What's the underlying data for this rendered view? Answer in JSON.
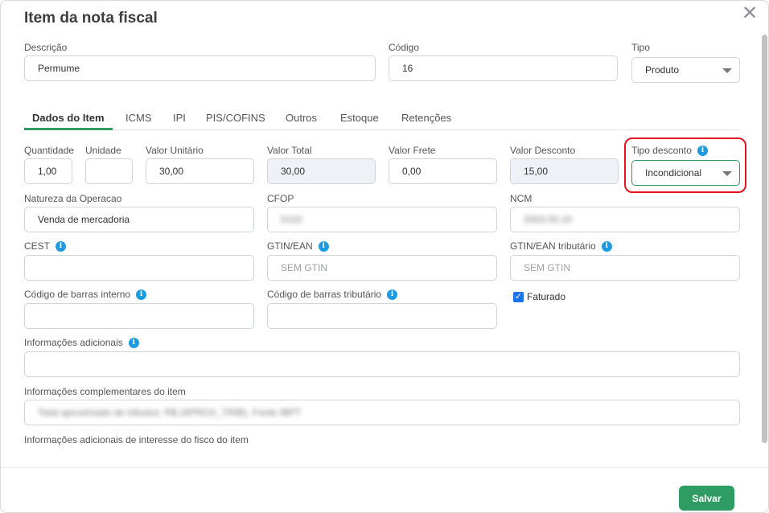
{
  "modal": {
    "title": "Item da nota fiscal",
    "close_glyph": "✕"
  },
  "header_fields": {
    "descricao": {
      "label": "Descrição",
      "value": "Permume"
    },
    "codigo": {
      "label": "Código",
      "value": "16"
    },
    "tipo": {
      "label": "Tipo",
      "value": "Produto"
    }
  },
  "tabs": [
    {
      "label": "Dados do Item",
      "active": true
    },
    {
      "label": "ICMS"
    },
    {
      "label": "IPI"
    },
    {
      "label": "PIS/COFINS"
    },
    {
      "label": "Outros"
    },
    {
      "label": "Estoque"
    },
    {
      "label": "Retenções"
    }
  ],
  "fields": {
    "quantidade": {
      "label": "Quantidade",
      "value": "1,00"
    },
    "unidade": {
      "label": "Unidade",
      "value": ""
    },
    "valor_unitario": {
      "label": "Valor Unitário",
      "value": "30,00"
    },
    "valor_total": {
      "label": "Valor Total",
      "value": "30,00"
    },
    "valor_frete": {
      "label": "Valor Frete",
      "value": "0,00"
    },
    "valor_desconto": {
      "label": "Valor Desconto",
      "value": "15,00"
    },
    "tipo_desconto": {
      "label": "Tipo desconto",
      "value": "Incondicional"
    },
    "natureza_operacao": {
      "label": "Natureza da Operacao",
      "value": "Venda de mercadoria"
    },
    "cfop": {
      "label": "CFOP",
      "value": "5102"
    },
    "ncm": {
      "label": "NCM",
      "value": "3303.00.10"
    },
    "cest": {
      "label": "CEST",
      "value": ""
    },
    "gtin_ean": {
      "label": "GTIN/EAN",
      "placeholder": "SEM GTIN"
    },
    "gtin_ean_tributario": {
      "label": "GTIN/EAN tributário",
      "placeholder": "SEM GTIN"
    },
    "codigo_barras_interno": {
      "label": "Código de barras interno",
      "value": ""
    },
    "codigo_barras_tributario": {
      "label": "Código de barras tributário",
      "value": ""
    },
    "faturado": {
      "label": "Faturado",
      "checked": true
    },
    "informacoes_adicionais": {
      "label": "Informações adicionais",
      "value": ""
    },
    "informacoes_complementares": {
      "label": "Informações complementares do item",
      "value": "Total aproximado de tributos: R$ (APROX_TRIB). Fonte IBPT"
    },
    "informacoes_fisco": {
      "label": "Informações adicionais de interesse do fisco do item"
    }
  },
  "footer": {
    "save_label": "Salvar"
  },
  "colors": {
    "accent": "#2f9d63",
    "info": "#1e9be0",
    "highlight": "#e5131f"
  }
}
